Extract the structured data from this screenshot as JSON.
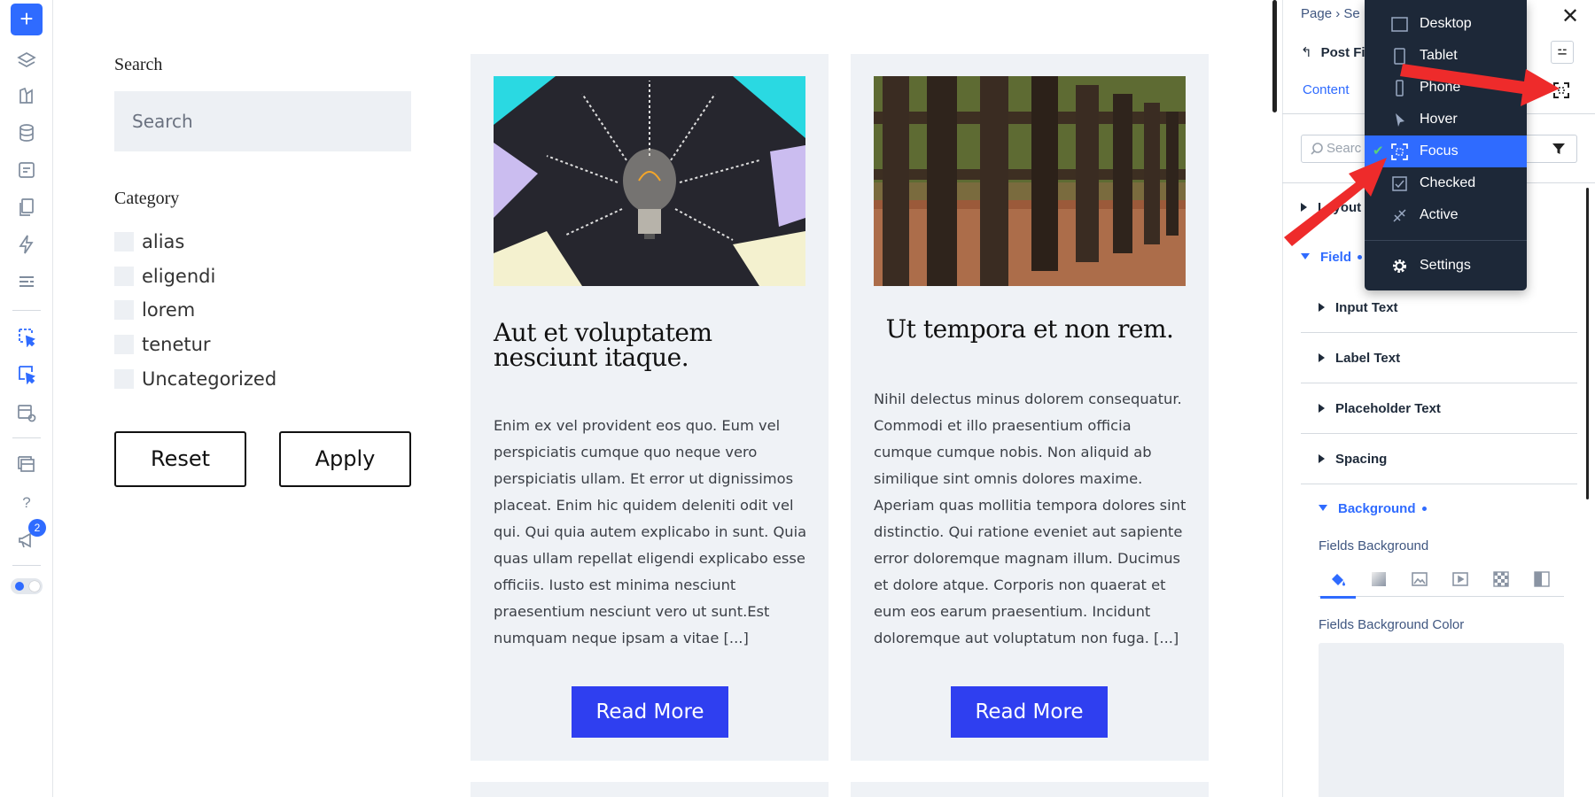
{
  "toolbar": {
    "add_label": "+",
    "icons": [
      "plus-icon",
      "layers-icon",
      "paint-palette-icon",
      "database-icon",
      "forms-icon",
      "pages-icon",
      "lightning-icon",
      "list-icon",
      "pointer-select-icon",
      "pointer-select-icon",
      "preview-icon",
      "templates-icon",
      "help-icon",
      "megaphone-icon",
      "theme-toggle-icon"
    ],
    "notification_count": "2"
  },
  "filter": {
    "search_label": "Search",
    "search_placeholder": "Search",
    "category_label": "Category",
    "categories": [
      "alias",
      "eligendi",
      "lorem",
      "tenetur",
      "Uncategorized"
    ],
    "reset_label": "Reset",
    "apply_label": "Apply"
  },
  "posts": [
    {
      "title": "Aut et voluptatem nesciunt itaque.",
      "excerpt": "Enim ex vel provident eos quo. Eum vel perspiciatis cumque quo neque vero perspiciatis ullam. Et error ut dignissimos placeat. Enim hic quidem deleniti odit vel qui. Qui quia autem explicabo in sunt. Quia quas ullam repellat eligendi explicabo esse officiis. Iusto est minima nesciunt praesentium nesciunt vero ut sunt.Est numquam neque ipsam a vitae [...]",
      "read_more": "Read More",
      "image": "lightbulb-photo"
    },
    {
      "title": "Ut tempora et non rem.",
      "excerpt": "Nihil delectus minus dolorem consequatur. Commodi et illo praesentium officia cumque cumque nobis. Non aliquid ab similique sint omnis dolores maxime. Aperiam quas mollitia tempora dolores sint distinctio. Qui ratione eveniet aut sapiente error doloremque magnam illum. Ducimus et dolore atque. Corporis non quaerat et eum eos earum praesentium. Incidunt doloremque aut voluptatum non fuga. [...]",
      "read_more": "Read More",
      "image": "wooden-fence-photo"
    }
  ],
  "panel": {
    "breadcrumb": "Page  ›  Se",
    "element_title": "Post Fi",
    "content_tab": "Content",
    "search_placeholder": "Searc",
    "sections": {
      "layout": "Layout",
      "field": "Field",
      "input_text": "Input Text",
      "label_text": "Label Text",
      "placeholder_text": "Placeholder Text",
      "spacing": "Spacing",
      "background": "Background"
    },
    "fields_background_label": "Fields Background",
    "fields_background_color_label": "Fields Background Color",
    "background_types": [
      "paint-bucket-icon",
      "gradient-icon",
      "image-icon",
      "video-icon",
      "pattern-icon",
      "mask-icon"
    ]
  },
  "state_menu": {
    "items": [
      {
        "label": "Desktop",
        "icon": "desktop-icon"
      },
      {
        "label": "Tablet",
        "icon": "tablet-icon"
      },
      {
        "label": "Phone",
        "icon": "phone-icon"
      },
      {
        "label": "Hover",
        "icon": "cursor-icon"
      },
      {
        "label": "Focus",
        "icon": "focus-icon",
        "selected": true
      },
      {
        "label": "Checked",
        "icon": "checkbox-icon"
      },
      {
        "label": "Active",
        "icon": "active-icon"
      }
    ],
    "settings_label": "Settings",
    "selected_check": "✔"
  },
  "colors": {
    "accent": "#2f6bff",
    "read_more_bg": "#2f3ff0",
    "card_bg": "#eff2f6",
    "menu_bg": "#1d2838",
    "annotation_arrow": "#ee2b2b"
  }
}
